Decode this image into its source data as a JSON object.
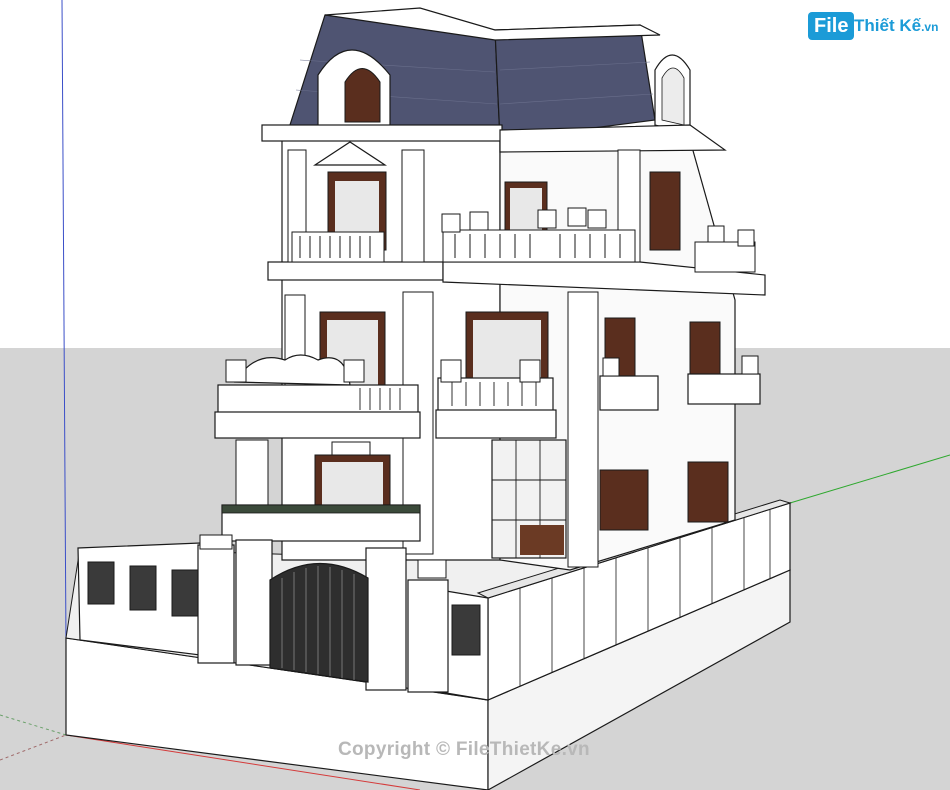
{
  "app": {
    "name": "SketchUp model viewport"
  },
  "colors": {
    "sky": "#ffffff",
    "ground": "#d4d4d4",
    "roof": "#4f5472",
    "wall": "#ffffff",
    "outline": "#1a1a1a",
    "window_frame": "#5a2e1e",
    "glass": "#e8e8e8",
    "axis_red": "#d43a3a",
    "axis_green": "#2ea82e",
    "axis_blue": "#3b4fc8",
    "brand_blue": "#1b9bd7",
    "watermark": "#b8b8b8"
  },
  "logo": {
    "badge": "File",
    "rest": "Thiết Kế",
    "suffix": ".vn"
  },
  "watermark": {
    "text": "Copyright © FileThietKe.vn"
  },
  "icons": {
    "axis": "axis-lines",
    "model": "villa-3d-model"
  }
}
